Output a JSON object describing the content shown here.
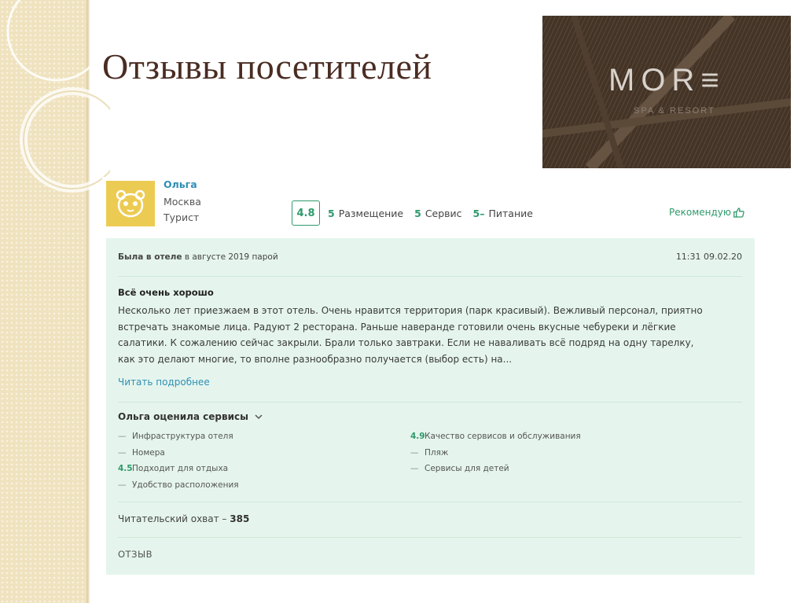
{
  "slide": {
    "title": "Отзывы посетителей"
  },
  "logo": {
    "text": "MOR≡",
    "subtitle": "SPA & RESORT"
  },
  "review": {
    "author": {
      "name": "Ольга",
      "city": "Москва",
      "type": "Турист"
    },
    "overall": "4.8",
    "ratings": [
      {
        "value": "5",
        "label": "Размещение"
      },
      {
        "value": "5",
        "label": "Сервис"
      },
      {
        "value": "5–",
        "label": "Питание"
      }
    ],
    "recommend": "Рекомендую",
    "stay_prefix": "Была в отеле",
    "stay_detail": "в августе 2019 парой",
    "datetime": "11:31 09.02.20",
    "title": "Всё очень хорошо",
    "text_lines": [
      "Несколько лет приезжаем в этот отель. Очень нравится территория (парк красивый). Вежливый персонал, приятно",
      "встречать знакомые лица. Радуют 2 ресторана. Раньше наверанде готовили очень вкусные чебуреки и лёгкие",
      "салатики. К сожалению сейчас закрыли. Брали только завтраки. Если не наваливать всё подряд на одну тарелку,",
      "как это делают многие, то вполне разнообразно получается (выбор есть) на..."
    ],
    "read_more": "Читать подробнее",
    "services_title": "Ольга оценила сервисы",
    "services_left": [
      {
        "mark": "—",
        "label": "Инфраструктура отеля"
      },
      {
        "mark": "—",
        "label": "Номера"
      },
      {
        "mark": "4.5",
        "label": "Подходит для отдыха"
      },
      {
        "mark": "—",
        "label": "Удобство расположения"
      }
    ],
    "services_right": [
      {
        "mark": "4.9",
        "label": "Качество сервисов и обслуживания"
      },
      {
        "mark": "—",
        "label": "Пляж"
      },
      {
        "mark": "—",
        "label": "Сервисы для детей"
      }
    ],
    "reach_label": "Читательский охват –",
    "reach_value": "385",
    "tag": "ОТЗЫВ"
  },
  "colors": {
    "accent_green": "#2e9a6b",
    "link_blue": "#2f8fb5",
    "body_bg": "#e5f5ed",
    "avatar_yellow": "#eccb52"
  }
}
